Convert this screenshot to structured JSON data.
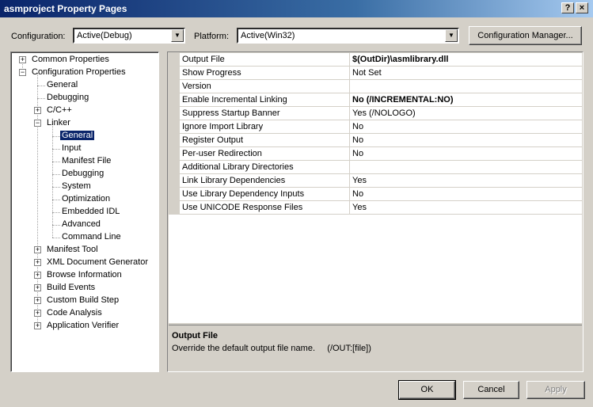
{
  "window": {
    "title": "asmproject Property Pages",
    "help_glyph": "?",
    "close_glyph": "×"
  },
  "toolbar": {
    "configuration_label": "Configuration:",
    "configuration_value": "Active(Debug)",
    "platform_label": "Platform:",
    "platform_value": "Active(Win32)",
    "config_manager_label": "Configuration Manager..."
  },
  "tree": {
    "nodes": [
      {
        "label": "Common Properties",
        "expander": "+"
      },
      {
        "label": "Configuration Properties",
        "expander": "-"
      },
      {
        "label": "General"
      },
      {
        "label": "Debugging"
      },
      {
        "label": "C/C++",
        "expander": "+"
      },
      {
        "label": "Linker",
        "expander": "-"
      },
      {
        "label": "General",
        "selected": true
      },
      {
        "label": "Input"
      },
      {
        "label": "Manifest File"
      },
      {
        "label": "Debugging"
      },
      {
        "label": "System"
      },
      {
        "label": "Optimization"
      },
      {
        "label": "Embedded IDL"
      },
      {
        "label": "Advanced"
      },
      {
        "label": "Command Line"
      },
      {
        "label": "Manifest Tool",
        "expander": "+"
      },
      {
        "label": "XML Document Generator",
        "expander": "+"
      },
      {
        "label": "Browse Information",
        "expander": "+"
      },
      {
        "label": "Build Events",
        "expander": "+"
      },
      {
        "label": "Custom Build Step",
        "expander": "+"
      },
      {
        "label": "Code Analysis",
        "expander": "+"
      },
      {
        "label": "Application Verifier",
        "expander": "+"
      }
    ]
  },
  "properties": [
    {
      "name": "Output File",
      "value": "$(OutDir)\\asmlibrary.dll",
      "bold": true
    },
    {
      "name": "Show Progress",
      "value": "Not Set",
      "bold": false
    },
    {
      "name": "Version",
      "value": "",
      "bold": false
    },
    {
      "name": "Enable Incremental Linking",
      "value": "No (/INCREMENTAL:NO)",
      "bold": true
    },
    {
      "name": "Suppress Startup Banner",
      "value": "Yes (/NOLOGO)",
      "bold": false
    },
    {
      "name": "Ignore Import Library",
      "value": "No",
      "bold": false
    },
    {
      "name": "Register Output",
      "value": "No",
      "bold": false
    },
    {
      "name": "Per-user Redirection",
      "value": "No",
      "bold": false
    },
    {
      "name": "Additional Library Directories",
      "value": "",
      "bold": false
    },
    {
      "name": "Link Library Dependencies",
      "value": "Yes",
      "bold": false
    },
    {
      "name": "Use Library Dependency Inputs",
      "value": "No",
      "bold": false
    },
    {
      "name": "Use UNICODE Response Files",
      "value": "Yes",
      "bold": false
    }
  ],
  "description": {
    "title": "Output File",
    "text": "Override the default output file name.     (/OUT:[file])"
  },
  "buttons": {
    "ok": "OK",
    "cancel": "Cancel",
    "apply": "Apply"
  }
}
